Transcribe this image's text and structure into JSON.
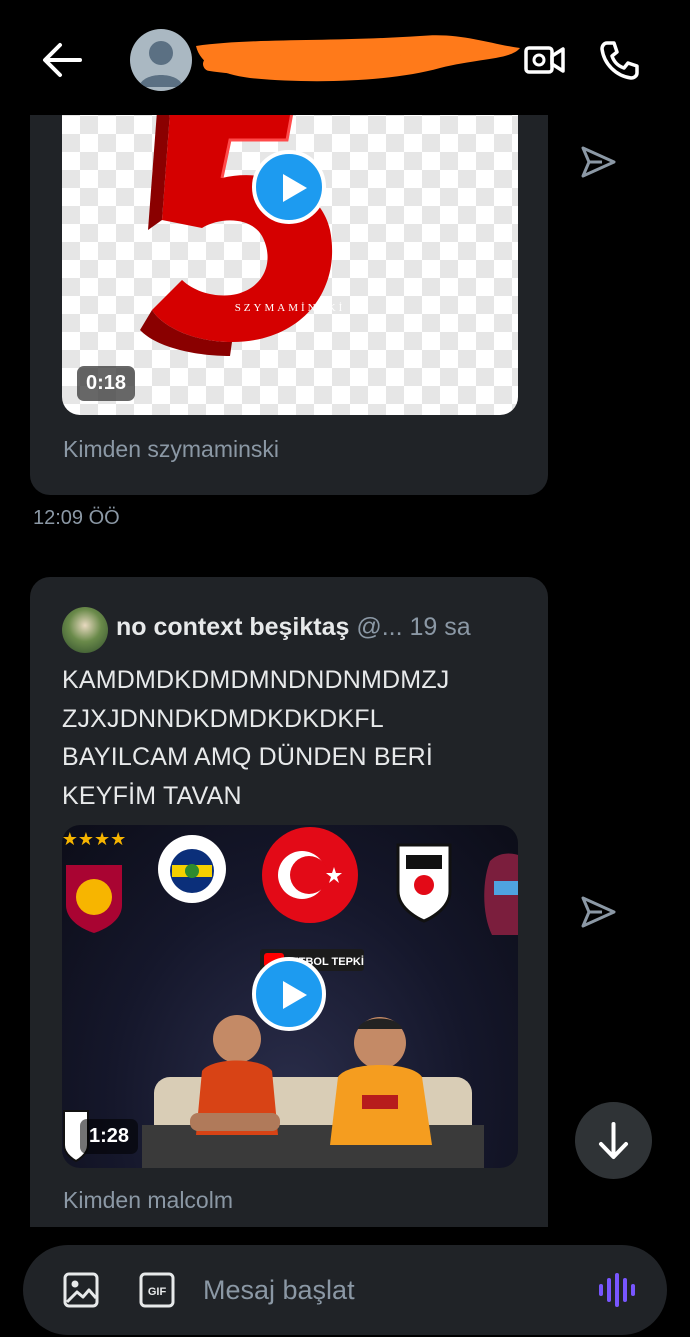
{
  "colors": {
    "background": "#000000",
    "bubble": "#202327",
    "accent": "#1d9bf0",
    "muted_text": "#8b98a5",
    "mic_accent": "#7856ff",
    "redaction": "#ff7a1a"
  },
  "header": {
    "back_icon": "arrow-left-icon",
    "contact_avatar_icon": "default-avatar-icon",
    "video_call_icon": "video-camera-icon",
    "voice_call_icon": "phone-icon"
  },
  "messages": [
    {
      "media_logo_text": "SZYMAMİNSKİ",
      "duration": "0:18",
      "from": "Kimden szymaminski",
      "time": "12:09 ÖÖ"
    },
    {
      "tweet": {
        "name": "no context beşiktaş",
        "handle": "@...",
        "age": "19 sa",
        "text_lines": [
          "KAMDMDKDMDMNDNDNMDMZJ",
          "ZJXJDNNDKDMDKDKDKFL",
          "BAYILCAM AMQ DÜNDEN BERİ",
          "KEYFİM TAVAN"
        ]
      },
      "video_banner": "FUTBOL TEPKİ",
      "duration": "1:28",
      "from": "Kimden malcolm"
    }
  ],
  "composer": {
    "placeholder": "Mesaj başlat",
    "gif_label": "GIF",
    "image_icon": "image-icon",
    "mic_icon": "voice-wave-icon"
  }
}
